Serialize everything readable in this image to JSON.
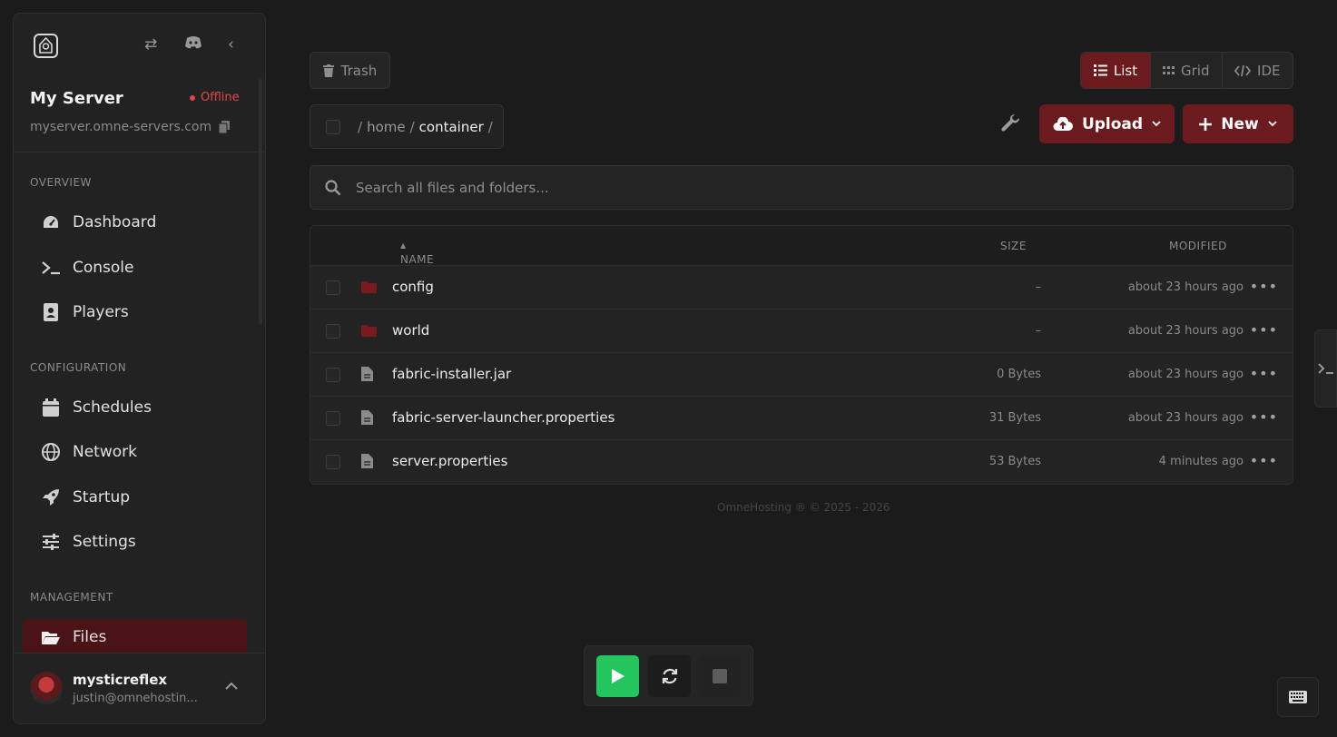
{
  "sidebar": {
    "server_name": "My Server",
    "status": "Offline",
    "status_color": "#e04848",
    "host": "myserver.omne-servers.com",
    "sections": {
      "overview": "OVERVIEW",
      "configuration": "CONFIGURATION",
      "management": "MANAGEMENT"
    },
    "items": {
      "dashboard": "Dashboard",
      "console": "Console",
      "players": "Players",
      "schedules": "Schedules",
      "network": "Network",
      "startup": "Startup",
      "settings": "Settings",
      "files": "Files"
    },
    "active_item": "Files",
    "user": {
      "name": "mysticreflex",
      "email": "justin@omnehostin..."
    }
  },
  "toolbar": {
    "trash_label": "Trash",
    "views": {
      "list": "List",
      "grid": "Grid",
      "ide": "IDE"
    },
    "active_view": "List",
    "upload_label": "Upload",
    "new_label": "New"
  },
  "breadcrumb": {
    "sep": "/",
    "home": "home",
    "current": "container"
  },
  "search": {
    "placeholder": "Search all files and folders..."
  },
  "table": {
    "columns": {
      "name": "NAME",
      "size": "SIZE",
      "modified": "MODIFIED"
    },
    "rows": [
      {
        "name": "config",
        "type": "folder",
        "size": "–",
        "modified": "about 23 hours ago"
      },
      {
        "name": "world",
        "type": "folder",
        "size": "–",
        "modified": "about 23 hours ago"
      },
      {
        "name": "fabric-installer.jar",
        "type": "file",
        "size": "0 Bytes",
        "modified": "about 23 hours ago"
      },
      {
        "name": "fabric-server-launcher.properties",
        "type": "file",
        "size": "31 Bytes",
        "modified": "about 23 hours ago"
      },
      {
        "name": "server.properties",
        "type": "file",
        "size": "53 Bytes",
        "modified": "4 minutes ago"
      }
    ]
  },
  "footer": "OmneHosting ® © 2025 - 2026",
  "colors": {
    "accent": "#6b1a1d",
    "start": "#22c55e",
    "folder": "#7a1a1d"
  }
}
